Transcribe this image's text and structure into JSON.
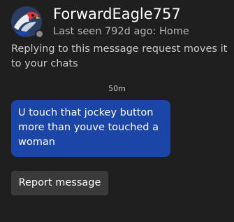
{
  "header": {
    "username": "ForwardEagle757",
    "last_seen": "Last seen 792d ago: Home",
    "avatar_icon": "eagle-avatar-icon",
    "presence_status": "offline"
  },
  "notice": {
    "text": "Replying to this message request moves it to your chats"
  },
  "conversation": {
    "timestamp": "50m",
    "messages": [
      {
        "text": "U touch that jockey button more than youve touched a woman",
        "direction": "incoming"
      }
    ]
  },
  "actions": {
    "report_label": "Report message"
  },
  "colors": {
    "background": "#1f1f1f",
    "bubble": "#1b46a8",
    "button": "#3a3a3a",
    "secondary_text": "#b5b5b5"
  }
}
